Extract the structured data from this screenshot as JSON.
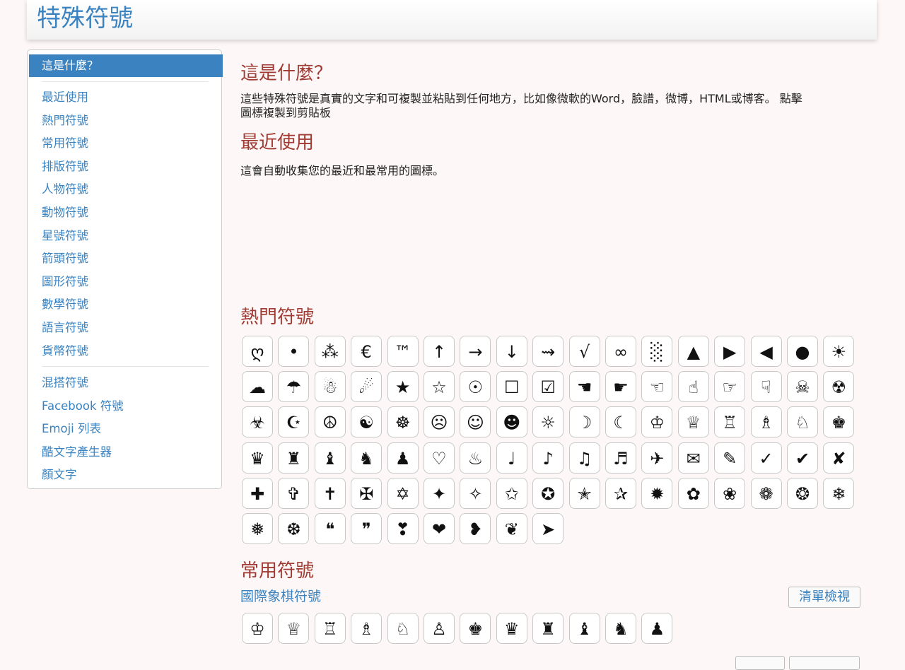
{
  "header": {
    "title": "特殊符號"
  },
  "sidebar": {
    "active": "這是什麼？",
    "group1": [
      "最近使用",
      "熱門符號",
      "常用符號",
      "排版符號",
      "人物符號",
      "動物符號",
      "星號符號",
      "箭頭符號",
      "圖形符號",
      "數學符號",
      "語言符號",
      "貨幣符號"
    ],
    "group2": [
      "混搭符號",
      "Facebook 符號",
      "Emoji 列表",
      "酷文字產生器",
      "顏文字"
    ]
  },
  "about": {
    "title": "這是什麼？",
    "text_line1": "這些特殊符號是真實的文字和可複製並粘貼到任何地方，比如像微軟的Word，臉譜，微博，HTML或博客。 點擊",
    "text_line2": "圖標複製到剪貼板"
  },
  "recent": {
    "title": "最近使用",
    "text": "這會自動收集您的最近和最常用的圖標。"
  },
  "popular": {
    "title": "熱門符號",
    "symbols": [
      "ღ",
      "•",
      "⁂",
      "€",
      "™",
      "↑",
      "→",
      "↓",
      "⇝",
      "√",
      "∞",
      "░",
      "▲",
      "▶",
      "◀",
      "●",
      "☀",
      "☁",
      "☂",
      "☃",
      "☄",
      "★",
      "☆",
      "☉",
      "☐",
      "☑",
      "☚",
      "☛",
      "☜",
      "☝",
      "☞",
      "☟",
      "☠",
      "☢",
      "☣",
      "☪",
      "☮",
      "☯",
      "☸",
      "☹",
      "☺",
      "☻",
      "☼",
      "☽",
      "☾",
      "♔",
      "♕",
      "♖",
      "♗",
      "♘",
      "♚",
      "♛",
      "♜",
      "♝",
      "♞",
      "♟",
      "♡",
      "♨",
      "♩",
      "♪",
      "♫",
      "♬",
      "✈",
      "✉",
      "✎",
      "✓",
      "✔",
      "✘",
      "✚",
      "✞",
      "✝",
      "✠",
      "✡",
      "✦",
      "✧",
      "✩",
      "✪",
      "✭",
      "✰",
      "✹",
      "✿",
      "❀",
      "❁",
      "❂",
      "❄",
      "❅",
      "❆",
      "❝",
      "❞",
      "❣",
      "❤",
      "❥",
      "❦",
      "➤"
    ]
  },
  "common": {
    "title": "常用符號",
    "subtitle": "國際象棋符號",
    "list_button": "清單檢視",
    "symbols": [
      "♔",
      "♕",
      "♖",
      "♗",
      "♘",
      "♙",
      "♚",
      "♛",
      "♜",
      "♝",
      "♞",
      "♟"
    ]
  }
}
